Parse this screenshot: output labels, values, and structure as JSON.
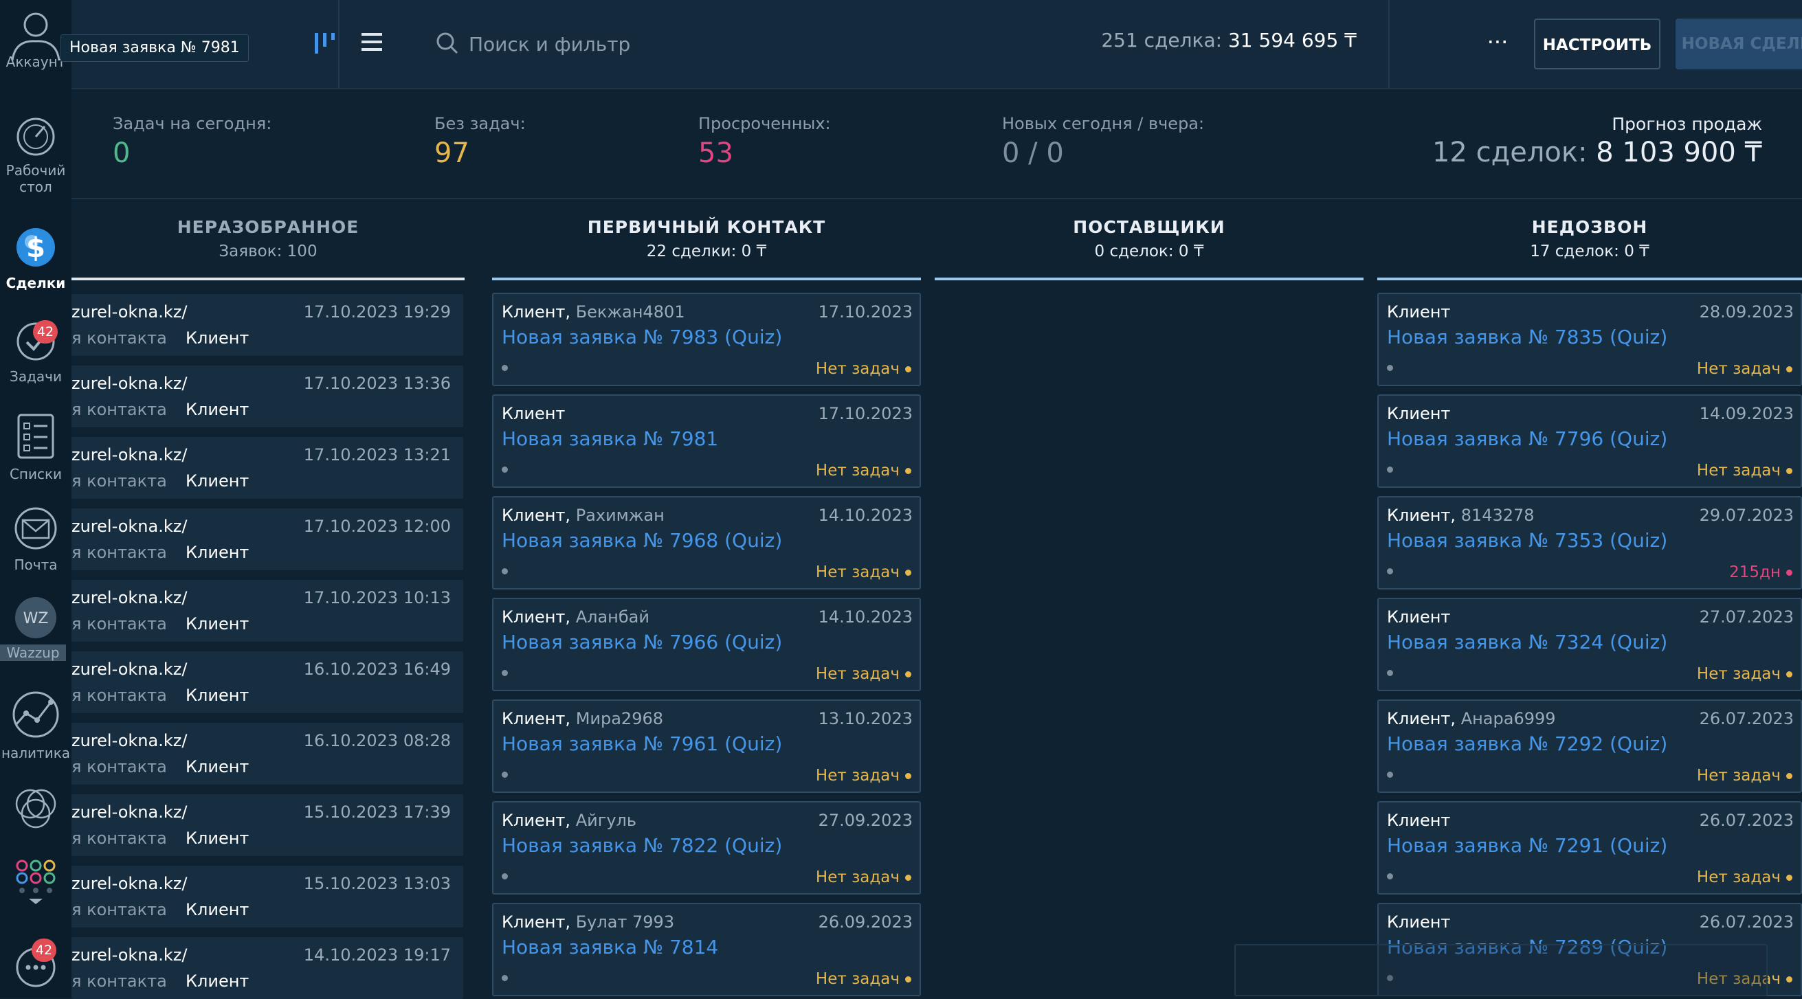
{
  "tooltip": "Новая заявка № 7981",
  "sidebar": {
    "account": "Аккаунт",
    "items": [
      {
        "label": "Рабочий\nстол",
        "icon": "dashboard-icon"
      },
      {
        "label": "Сделки",
        "icon": "deals-icon"
      },
      {
        "label": "Задачи",
        "icon": "tasks-icon",
        "badge": "42"
      },
      {
        "label": "Списки",
        "icon": "lists-icon"
      },
      {
        "label": "Почта",
        "icon": "mail-icon"
      },
      {
        "label": "Wazzup",
        "icon": "wazzup-icon"
      },
      {
        "label": "налитика",
        "icon": "analytics-icon"
      }
    ],
    "chat_badge": "42",
    "wazzup_short": "WZ"
  },
  "header": {
    "search_placeholder": "Поиск и фильтр",
    "deals_count": "251 сделка:",
    "deals_sum": "31 594 695 ₸",
    "more": "···",
    "settings": "НАСТРОИТЬ",
    "new_deal": "НОВАЯ СДЕЛКА"
  },
  "stats": {
    "today_label": "Задач на сегодня:",
    "today_value": "0",
    "no_tasks_label": "Без задач:",
    "no_tasks_value": "97",
    "overdue_label": "Просроченных:",
    "overdue_value": "53",
    "new_label": "Новых сегодня / вчера:",
    "new_value": "0 / 0",
    "forecast_title": "Прогноз продаж",
    "forecast_count": "12 сделок:",
    "forecast_sum": "8 103 900 ₸"
  },
  "columns": [
    {
      "title": "НЕРАЗОБРАННОЕ",
      "sub": "Заявок: 100"
    },
    {
      "title": "ПЕРВИЧНЫЙ КОНТАКТ",
      "sub": "22 сделки: 0 ₸"
    },
    {
      "title": "ПОСТАВЩИКИ",
      "sub": "0 сделок: 0 ₸"
    },
    {
      "title": "НЕДОЗВОН",
      "sub": "17 сделок: 0 ₸"
    }
  ],
  "leads": [
    {
      "url": "zurel-okna.kz/",
      "contact": "я контакта",
      "client": "Клиент",
      "date": "17.10.2023 19:29"
    },
    {
      "url": "zurel-okna.kz/",
      "contact": "я контакта",
      "client": "Клиент",
      "date": "17.10.2023 13:36"
    },
    {
      "url": "zurel-okna.kz/",
      "contact": "я контакта",
      "client": "Клиент",
      "date": "17.10.2023 13:21"
    },
    {
      "url": "zurel-okna.kz/",
      "contact": "я контакта",
      "client": "Клиент",
      "date": "17.10.2023 12:00"
    },
    {
      "url": "zurel-okna.kz/",
      "contact": "я контакта",
      "client": "Клиент",
      "date": "17.10.2023 10:13"
    },
    {
      "url": "zurel-okna.kz/",
      "contact": "я контакта",
      "client": "Клиент",
      "date": "16.10.2023 16:49"
    },
    {
      "url": "zurel-okna.kz/",
      "contact": "я контакта",
      "client": "Клиент",
      "date": "16.10.2023 08:28"
    },
    {
      "url": "zurel-okna.kz/",
      "contact": "я контакта",
      "client": "Клиент",
      "date": "15.10.2023 17:39"
    },
    {
      "url": "zurel-okna.kz/",
      "contact": "я контакта",
      "client": "Клиент",
      "date": "15.10.2023 13:03"
    },
    {
      "url": "zurel-okna.kz/",
      "contact": "я контакта",
      "client": "Клиент",
      "date": "14.10.2023 19:17"
    }
  ],
  "primary": [
    {
      "client": "Клиент,",
      "name": "Бекжан4801",
      "date": "17.10.2023",
      "title": "Новая заявка № 7983 (Quiz)",
      "status": "Нет задач",
      "overdue": false
    },
    {
      "client": "Клиент",
      "name": "",
      "date": "17.10.2023",
      "title": "Новая заявка № 7981",
      "status": "Нет задач",
      "overdue": false
    },
    {
      "client": "Клиент,",
      "name": "Рахимжан",
      "date": "14.10.2023",
      "title": "Новая заявка № 7968 (Quiz)",
      "status": "Нет задач",
      "overdue": false
    },
    {
      "client": "Клиент,",
      "name": "Аланбай",
      "date": "14.10.2023",
      "title": "Новая заявка № 7966 (Quiz)",
      "status": "Нет задач",
      "overdue": false
    },
    {
      "client": "Клиент,",
      "name": "Мира2968",
      "date": "13.10.2023",
      "title": "Новая заявка № 7961 (Quiz)",
      "status": "Нет задач",
      "overdue": false
    },
    {
      "client": "Клиент,",
      "name": "Айгуль",
      "date": "27.09.2023",
      "title": "Новая заявка № 7822 (Quiz)",
      "status": "Нет задач",
      "overdue": false
    },
    {
      "client": "Клиент,",
      "name": "Булат 7993",
      "date": "26.09.2023",
      "title": "Новая заявка № 7814",
      "status": "Нет задач",
      "overdue": false
    }
  ],
  "missed": [
    {
      "client": "Клиент",
      "name": "",
      "date": "28.09.2023",
      "title": "Новая заявка № 7835 (Quiz)",
      "status": "Нет задач",
      "overdue": false
    },
    {
      "client": "Клиент",
      "name": "",
      "date": "14.09.2023",
      "title": "Новая заявка № 7796 (Quiz)",
      "status": "Нет задач",
      "overdue": false
    },
    {
      "client": "Клиент,",
      "name": "8143278",
      "date": "29.07.2023",
      "title": "Новая заявка № 7353 (Quiz)",
      "status": "215дн",
      "overdue": true
    },
    {
      "client": "Клиент",
      "name": "",
      "date": "27.07.2023",
      "title": "Новая заявка № 7324 (Quiz)",
      "status": "Нет задач",
      "overdue": false
    },
    {
      "client": "Клиент,",
      "name": "Анара6999",
      "date": "26.07.2023",
      "title": "Новая заявка № 7292 (Quiz)",
      "status": "Нет задач",
      "overdue": false
    },
    {
      "client": "Клиент",
      "name": "",
      "date": "26.07.2023",
      "title": "Новая заявка № 7291 (Quiz)",
      "status": "Нет задач",
      "overdue": false
    },
    {
      "client": "Клиент",
      "name": "",
      "date": "26.07.2023",
      "title": "Новая заявка № 7289 (Quiz)",
      "status": "Нет задач",
      "overdue": false
    }
  ],
  "colors": {
    "accent_blue": "#4596e8",
    "today_green": "#4fb98d",
    "no_tasks_yellow": "#e6b64a",
    "overdue_pink": "#e5457e",
    "column_line_blue": "#9ec7ee"
  }
}
